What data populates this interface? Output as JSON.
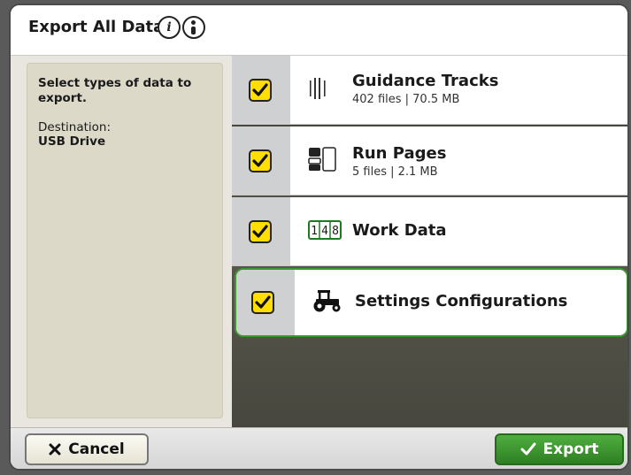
{
  "dialog": {
    "title": "Export All Data",
    "info_icons": [
      "info-icon",
      "info-icon-2"
    ]
  },
  "left_panel": {
    "instruction": "Select types of data to export.",
    "destination_label": "Destination:",
    "destination_value": "USB Drive"
  },
  "items": [
    {
      "name": "Guidance Tracks",
      "meta": "402 files | 70.5 MB",
      "checked": true,
      "icon": "guidance-tracks-icon"
    },
    {
      "name": "Run Pages",
      "meta": "5 files | 2.1 MB",
      "checked": true,
      "icon": "run-pages-icon"
    },
    {
      "name": "Work Data",
      "meta": "",
      "checked": true,
      "icon": "work-data-counter-icon",
      "icon_digits": "148"
    },
    {
      "name": "Settings Configurations",
      "meta": "",
      "checked": true,
      "icon": "tractor-icon",
      "selected": true
    }
  ],
  "footer": {
    "cancel_label": "Cancel",
    "export_label": "Export"
  },
  "colors": {
    "checkbox": "#ffde00",
    "selection_border": "#3a9a2f",
    "export_button": "#3f9a31"
  }
}
